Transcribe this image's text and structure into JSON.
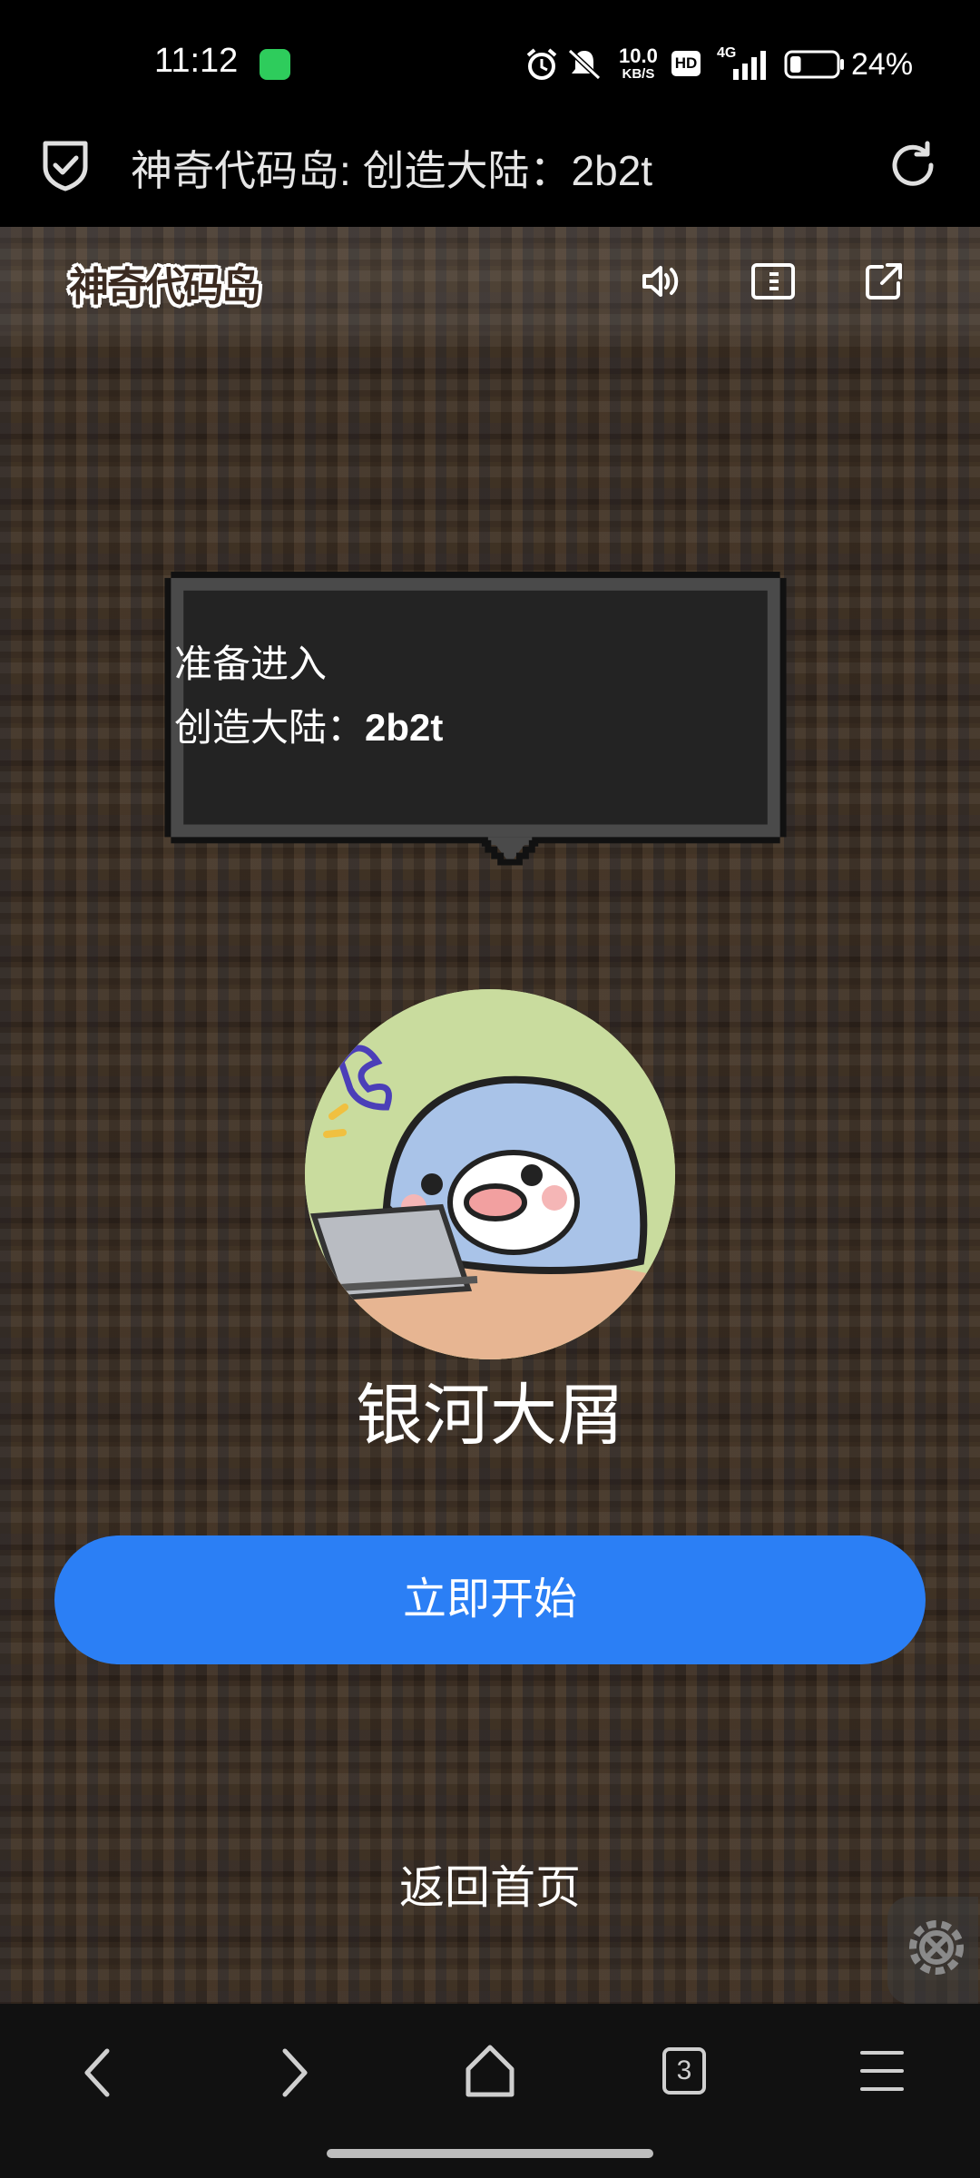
{
  "status_bar": {
    "time": "11:12",
    "network_speed": "10.0",
    "network_speed_unit": "KB/S",
    "hd_label": "HD",
    "signal_label": "4G",
    "battery_percent": "24%",
    "battery_level": 0.24
  },
  "browser": {
    "page_title": "神奇代码岛: 创造大陆：2b2t"
  },
  "game_header": {
    "logo_text": "神奇代码岛"
  },
  "dialog": {
    "line1": "准备进入",
    "line2_prefix": "创造大陆：",
    "line2_world": "2b2t"
  },
  "player": {
    "name": "银河大屑"
  },
  "actions": {
    "start_label": "立即开始",
    "home_label": "返回首页"
  },
  "nav": {
    "tab_count": "3"
  },
  "colors": {
    "primary_button": "#2b7ff5",
    "dialog_bg": "#232323",
    "dialog_border": "#4a4a4a"
  }
}
